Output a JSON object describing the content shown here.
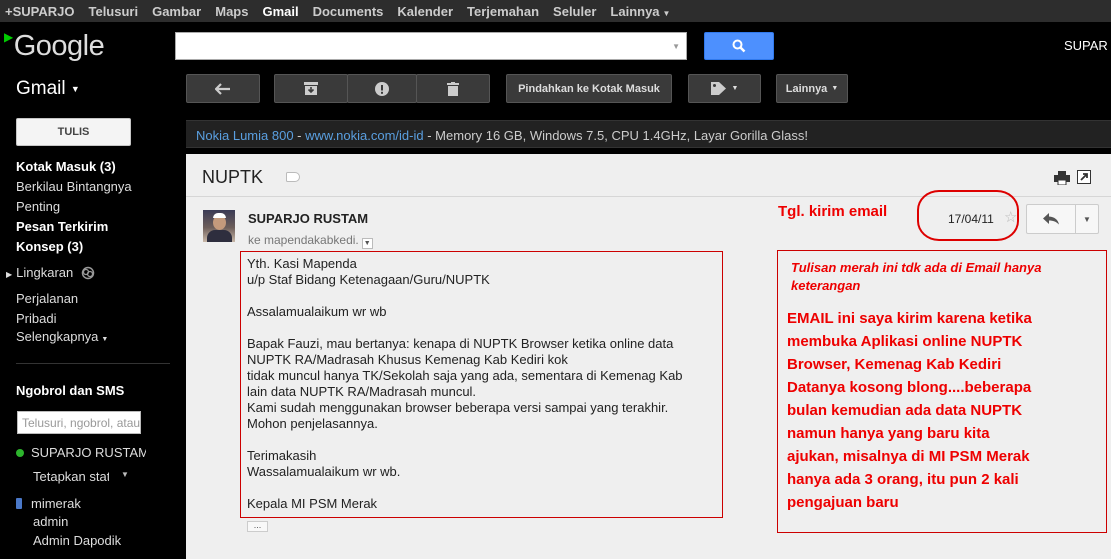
{
  "topnav": {
    "items": [
      {
        "label": "+SUPARJO",
        "active": false
      },
      {
        "label": "Telusuri",
        "active": false
      },
      {
        "label": "Gambar",
        "active": false
      },
      {
        "label": "Maps",
        "active": false
      },
      {
        "label": "Gmail",
        "active": true
      },
      {
        "label": "Documents",
        "active": false
      },
      {
        "label": "Kalender",
        "active": false
      },
      {
        "label": "Terjemahan",
        "active": false
      },
      {
        "label": "Seluler",
        "active": false
      },
      {
        "label": "Lainnya",
        "active": false
      }
    ]
  },
  "header": {
    "logo": "Google",
    "search_value": "",
    "search_button_icon": "search-icon",
    "user": "SUPAR"
  },
  "gmail_label": "Gmail",
  "toolbar": {
    "back_icon": "back-arrow-icon",
    "archive_icon": "archive-icon",
    "spam_icon": "spam-icon",
    "delete_icon": "trash-icon",
    "move_to_inbox_label": "Pindahkan ke Kotak Masuk",
    "labels_icon": "label-tag-icon",
    "more_label": "Lainnya"
  },
  "sidebar": {
    "compose_label": "TULIS",
    "items": [
      {
        "label": "Kotak Masuk (3)",
        "bold": true
      },
      {
        "label": "Berkilau Bintangnya",
        "bold": false
      },
      {
        "label": "Penting",
        "bold": false
      },
      {
        "label": "Pesan Terkirim",
        "bold": true
      },
      {
        "label": "Konsep (3)",
        "bold": true
      },
      {
        "label": "Lingkaran",
        "bold": false
      },
      {
        "label": "Perjalanan",
        "bold": false
      },
      {
        "label": "Pribadi",
        "bold": false
      },
      {
        "label": "Selengkapnya",
        "bold": false
      }
    ],
    "chat_title": "Ngobrol dan SMS",
    "chat_search_placeholder": "Telusuri, ngobrol, atau SMS",
    "chat_contacts": [
      {
        "name": "SUPARJO RUSTAM",
        "status": "online"
      },
      {
        "name": "Tetapkan status di sini"
      },
      {
        "name": "mimerak",
        "status": "mobile"
      },
      {
        "name": "admin"
      },
      {
        "name": "Admin Dapodik"
      }
    ]
  },
  "ad": {
    "title": "Nokia Lumia 800",
    "separator": " - ",
    "url": "www.nokia.com/id-id",
    "text": " - Memory 16 GB, Windows 7.5, CPU 1.4GHz, Layar Gorilla Glass!"
  },
  "message": {
    "subject": "NUPTK",
    "sender": "SUPARJO RUSTAM",
    "recipient": "ke mapendakabkedi.",
    "date": "17/04/11",
    "body_lines": [
      "Yth. Kasi Mapenda",
      "u/p Staf Bidang Ketenagaan/Guru/NUPTK",
      "",
      "Assalamualaikum wr wb",
      "",
      "Bapak Fauzi, mau bertanya: kenapa di NUPTK Browser ketika online data",
      "NUPTK RA/Madrasah Khusus Kemenag Kab Kediri kok",
      "tidak muncul hanya TK/Sekolah saja yang ada, sementara di Kemenag Kab",
      "lain data NUPTK RA/Madrasah muncul.",
      "Kami sudah menggunakan browser beberapa versi sampai yang terakhir.",
      "Mohon penjelasannya.",
      "",
      "Terimakasih",
      "Wassalamualaikum wr wb.",
      "",
      "Kepala MI PSM Merak"
    ],
    "ellipsis": "..."
  },
  "annotations": {
    "date_label": "Tgl. kirim email",
    "note_italic_1": "Tulisan merah ini tdk ada di Email hanya",
    "note_italic_2": "keterangan",
    "note_main_lines": [
      "EMAIL ini saya kirim karena ketika",
      "membuka Aplikasi online NUPTK",
      "Browser, Kemenag Kab Kediri",
      "Datanya kosong blong....beberapa",
      "bulan kemudian ada data NUPTK",
      "namun hanya yang baru kita",
      "ajukan, misalnya di MI PSM Merak",
      "hanya ada 3 orang, itu pun 2 kali",
      "pengajuan baru"
    ],
    "color": "#e00000"
  }
}
